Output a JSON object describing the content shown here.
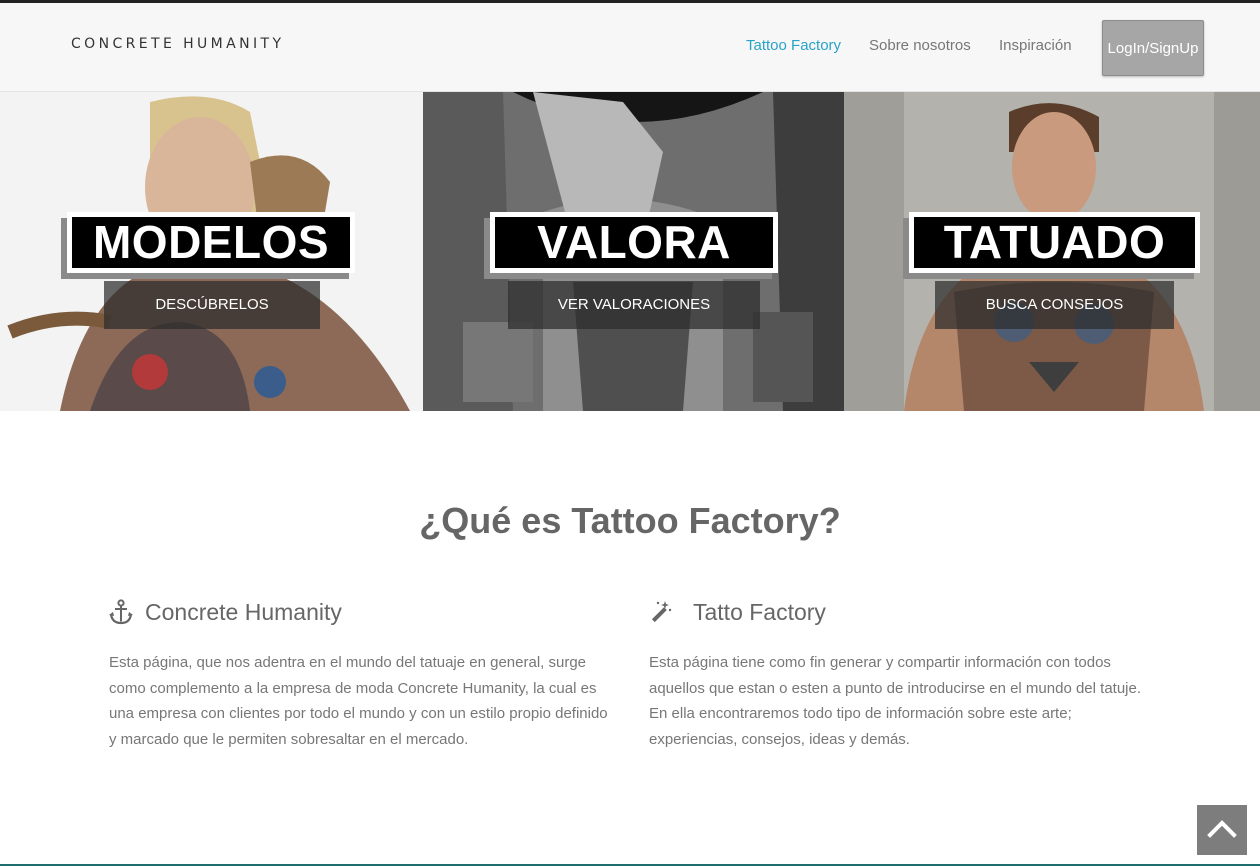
{
  "nav": {
    "brand": "CONCRETE HUMANITY",
    "links": [
      "Tattoo Factory",
      "Sobre nosotros",
      "Inspiración"
    ],
    "login": "LogIn/SignUp"
  },
  "hero": {
    "panels": [
      {
        "title": "MODELOS",
        "button": "DESCÚBRELOS"
      },
      {
        "title": "VALORA",
        "button": "VER VALORACIONES"
      },
      {
        "title": "TATUADO",
        "button": "BUSCA CONSEJOS"
      }
    ]
  },
  "about": {
    "title": "¿Qué es Tattoo Factory?",
    "left": {
      "heading": "Concrete Humanity",
      "icon": "anchor-icon",
      "text": "Esta página, que nos adentra en el mundo del tatuaje en general, surge como complemento a la empresa de moda Concrete Humanity, la cual es una empresa con clientes por todo el mundo y con un estilo propio definido y marcado que le permiten sobresaltar en el mercado."
    },
    "right": {
      "heading": "Tatto Factory",
      "icon": "magic-wand-icon",
      "text": "Esta página tiene como fin generar y compartir información con todos aquellos que estan o esten a punto de introducirse en el mundo del tatuje. En ella encontraremos todo tipo de información sobre este arte; experiencias, consejos, ideas y demás."
    }
  },
  "colors": {
    "accent": "#29a3c8",
    "login_bg": "#a6a6a6",
    "to_top_bg": "#7d7d7d"
  }
}
